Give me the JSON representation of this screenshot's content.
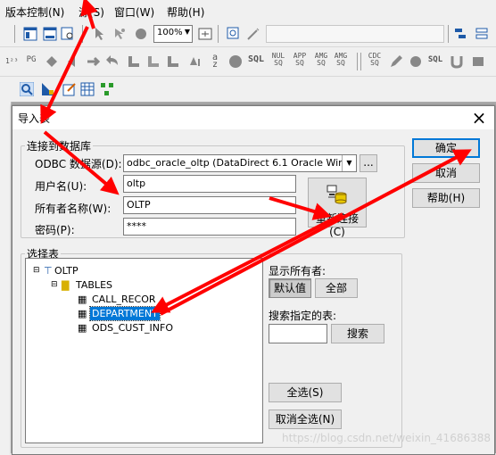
{
  "menu": {
    "items": [
      "版本控制(N)",
      "源(S)",
      "窗口(W)",
      "帮助(H)"
    ]
  },
  "toolbar": {
    "zoom_value": "100%",
    "labels": [
      "PG",
      "SQL",
      "NUL",
      "APP",
      "AMG",
      "CDC",
      "SQL"
    ]
  },
  "dialog": {
    "title": "导入表",
    "connect_group_title": "连接到数据库",
    "odbc_label": "ODBC 数据源(D):",
    "odbc_value": "odbc_oracle_oltp (DataDirect 6.1 Oracle Wire Prot",
    "browse_label": "...",
    "username_label": "用户名(U):",
    "username_value": "oltp",
    "owner_label": "所有者名称(W):",
    "owner_value": "OLTP",
    "password_label": "密码(P):",
    "password_value": "****",
    "reconnect_label": "重新连接(C)",
    "ok_label": "确定",
    "cancel_label": "取消",
    "help_label": "帮助(H)",
    "select_group_title": "选择表",
    "tree": {
      "root": "OLTP",
      "folder": "TABLES",
      "tables": [
        "CALL_RECOR",
        "DEPARTMENT",
        "ODS_CUST_INFO"
      ],
      "selected": "DEPARTMENT"
    },
    "show_owner_label": "显示所有者:",
    "default_label": "默认值",
    "all_label": "全部",
    "search_label": "搜索指定的表:",
    "search_value": "",
    "search_button": "搜索",
    "select_all_label": "全选(S)",
    "deselect_all_label": "取消全选(N)"
  },
  "watermark": "https://blog.csdn.net/weixin_41686388",
  "colors": {
    "annotation_arrow": "#ff0000",
    "selection": "#0078d7"
  }
}
